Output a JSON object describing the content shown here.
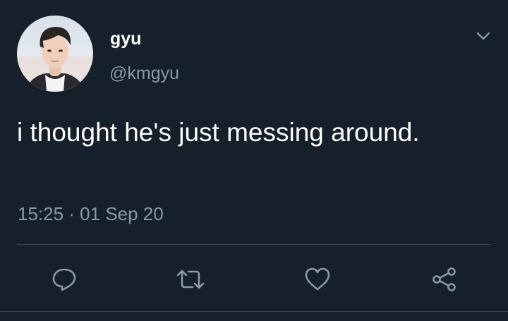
{
  "tweet": {
    "display_name": "gyu",
    "handle": "@kmgyu",
    "text": "i thought he's just messing around.",
    "timestamp": "15:25 · 01 Sep 20"
  },
  "actions": [
    {
      "icon": "reply-icon"
    },
    {
      "icon": "retweet-icon"
    },
    {
      "icon": "like-icon"
    },
    {
      "icon": "share-icon"
    }
  ],
  "colors": {
    "background": "#15202b",
    "primary_text": "#ffffff",
    "secondary_text": "#8899a6",
    "divider": "#38444d"
  }
}
